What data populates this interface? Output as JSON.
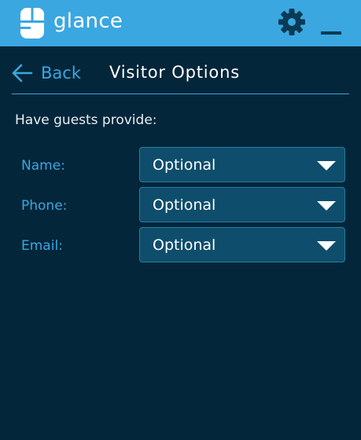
{
  "app": {
    "name": "glance"
  },
  "colors": {
    "titlebar": "#3aa7e1",
    "background": "#04263a",
    "accent": "#3aa7e1",
    "select_bg": "#0e4d6c"
  },
  "titlebar": {
    "icons": [
      "glance-logo-icon",
      "gear-icon",
      "minimize-icon"
    ]
  },
  "header": {
    "back_label": "Back",
    "title": "Visitor Options"
  },
  "section": {
    "heading": "Have guests provide:"
  },
  "fields": [
    {
      "label": "Name:",
      "value": "Optional"
    },
    {
      "label": "Phone:",
      "value": "Optional"
    },
    {
      "label": "Email:",
      "value": "Optional"
    }
  ]
}
